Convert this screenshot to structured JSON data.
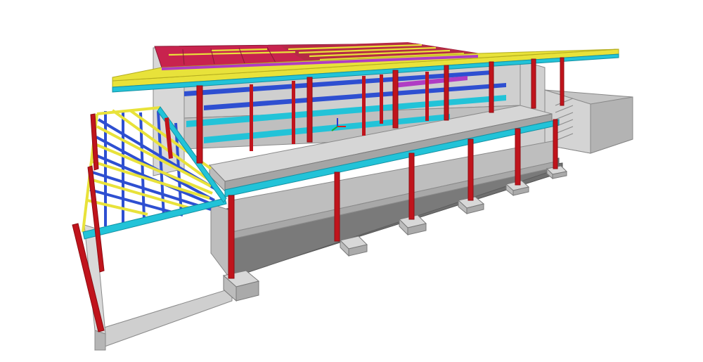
{
  "scene": {
    "background": "#ffffff",
    "colors": {
      "column": "#c0141c",
      "column_dark": "#8e0c12",
      "girder": "#22c3d8",
      "girder_dark": "#1491a3",
      "joist": "#2e4fd1",
      "purlin": "#e8e23a",
      "purlin_dark": "#b4ad1f",
      "roof_deck": "#c8234e",
      "brace": "#b03cc4",
      "concrete": "#c9c9c9",
      "concrete_dark": "#9a9a9a",
      "concrete_light": "#e2e2e2",
      "floor_shadow": "#6e6e6e"
    },
    "axis_triad": {
      "x_color": "#e0201a",
      "y_color": "#1eaa2c",
      "z_color": "#2238d6"
    }
  }
}
